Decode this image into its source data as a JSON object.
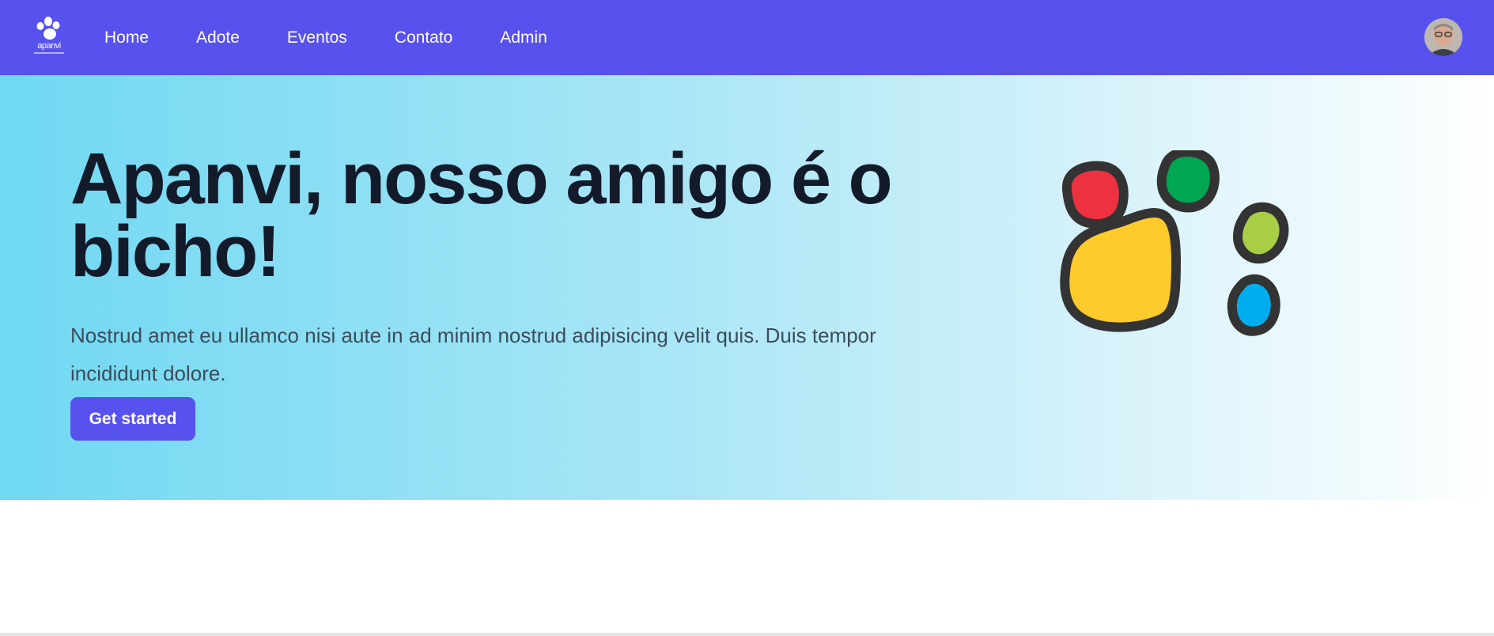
{
  "brand": {
    "logo_text": "apanvi",
    "icon": "paw-logo-icon"
  },
  "nav": {
    "items": [
      {
        "label": "Home"
      },
      {
        "label": "Adote"
      },
      {
        "label": "Eventos"
      },
      {
        "label": "Contato"
      },
      {
        "label": "Admin"
      }
    ],
    "avatar_icon": "user-avatar"
  },
  "hero": {
    "title": "Apanvi, nosso amigo é o bicho!",
    "description": "Nostrud amet eu ullamco nisi aute in ad minim nostrud adipisicing velit quis. Duis tempor incididunt dolore.",
    "cta_label": "Get started",
    "illustration": "colorful-paw-icon"
  },
  "colors": {
    "nav_bg": "#5751ee",
    "hero_gradient_start": "#6fd8f2",
    "hero_gradient_end": "#ffffff",
    "title": "#131b2b",
    "cta_bg": "#5751ee",
    "paw_red": "#ee3140",
    "paw_green": "#00a651",
    "paw_lime": "#a8ce45",
    "paw_yellow": "#ffca2b",
    "paw_blue": "#00adee"
  }
}
